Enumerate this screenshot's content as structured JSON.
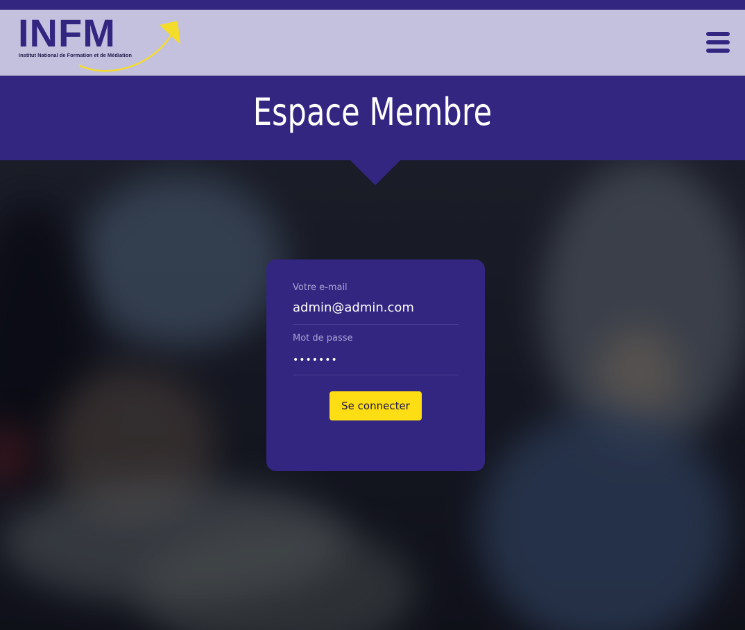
{
  "header": {
    "logo": {
      "letters": "INFM",
      "tagline": "Institut National de Formation et de Médiation"
    },
    "menu_icon": "hamburger-menu-icon"
  },
  "hero": {
    "title": "Espace Membre"
  },
  "login": {
    "email_label": "Votre e-mail",
    "email_value": "admin@admin.com",
    "password_label": "Mot de passe",
    "password_value": "•••••••",
    "submit_label": "Se connecter"
  },
  "colors": {
    "primary": "#332681",
    "navbar_bg": "#c4c1df",
    "accent": "#fddd13",
    "field_label": "#a7a3d4"
  }
}
